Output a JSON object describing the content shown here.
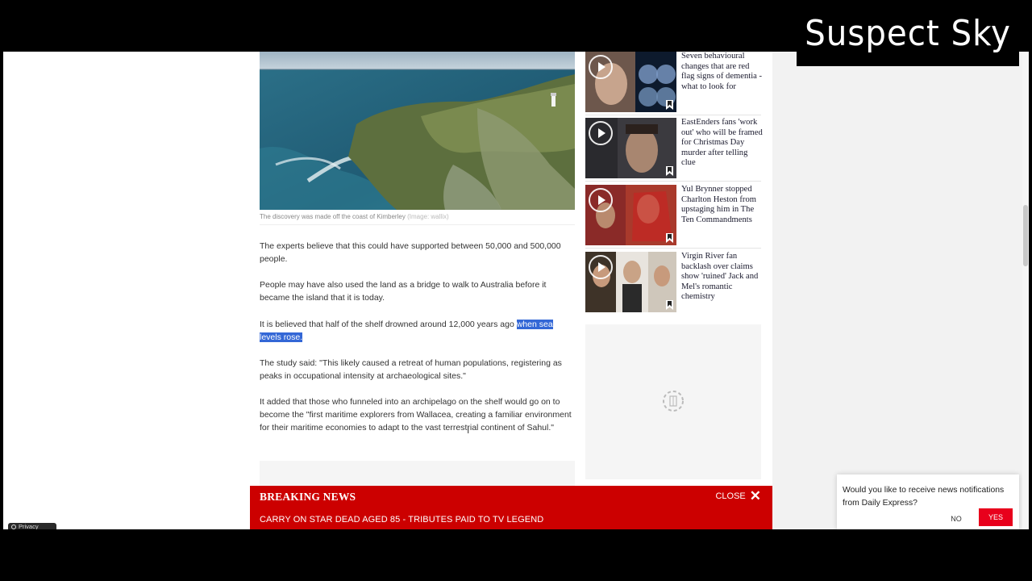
{
  "watermark": {
    "text": "Suspect Sky"
  },
  "article": {
    "caption": "The discovery was made off the coast of Kimberley",
    "caption_credit": "(Image: wallix)",
    "paragraphs": [
      "The experts believe that this could have supported between 50,000 and 500,000 people.",
      "People may have also used the land as a bridge to walk to Australia before it became the island that it is today."
    ],
    "p3_before": "It is believed that half of the shelf drowned around 12,000 years ago ",
    "p3_selected_a": "when sea",
    "p3_selected_b": "levels rose.",
    "p4": "The study said: \"This likely caused a retreat of human populations, registering as peaks in occupational intensity at archaeological sites.\"",
    "p5": "It added that those who funneled into an archipelago on the shelf would go on to become the \"first maritime explorers from Wallacea, creating a familiar environment for their maritime economies to adapt to the vast terrestrial continent of Sahul.\""
  },
  "sidebar": {
    "items": [
      {
        "title": "Seven behavioural changes that are red flag signs of dementia - what to look for",
        "icon": "play-icon"
      },
      {
        "title": "EastEnders fans 'work out' who will be framed for Christmas Day murder after telling clue",
        "icon": "play-icon"
      },
      {
        "title": "Yul Brynner stopped Charlton Heston from upstaging him in The Ten Commandments",
        "icon": "play-icon"
      },
      {
        "title": "Virgin River fan backlash over claims show 'ruined' Jack and Mel's romantic chemistry",
        "icon": "play-icon"
      }
    ]
  },
  "breaking": {
    "label": "BREAKING NEWS",
    "close_label": "CLOSE",
    "headline": "CARRY ON STAR DEAD AGED 85 - TRIBUTES PAID TO TV LEGEND"
  },
  "notification": {
    "message": "Would you like to receive news notifications from Daily Express?",
    "no_label": "NO",
    "yes_label": "YES"
  },
  "privacy": {
    "label": "Privacy"
  },
  "colors": {
    "breaking_red": "#cc0000",
    "yes_red": "#e8001c",
    "selection_blue": "#3367d6"
  }
}
